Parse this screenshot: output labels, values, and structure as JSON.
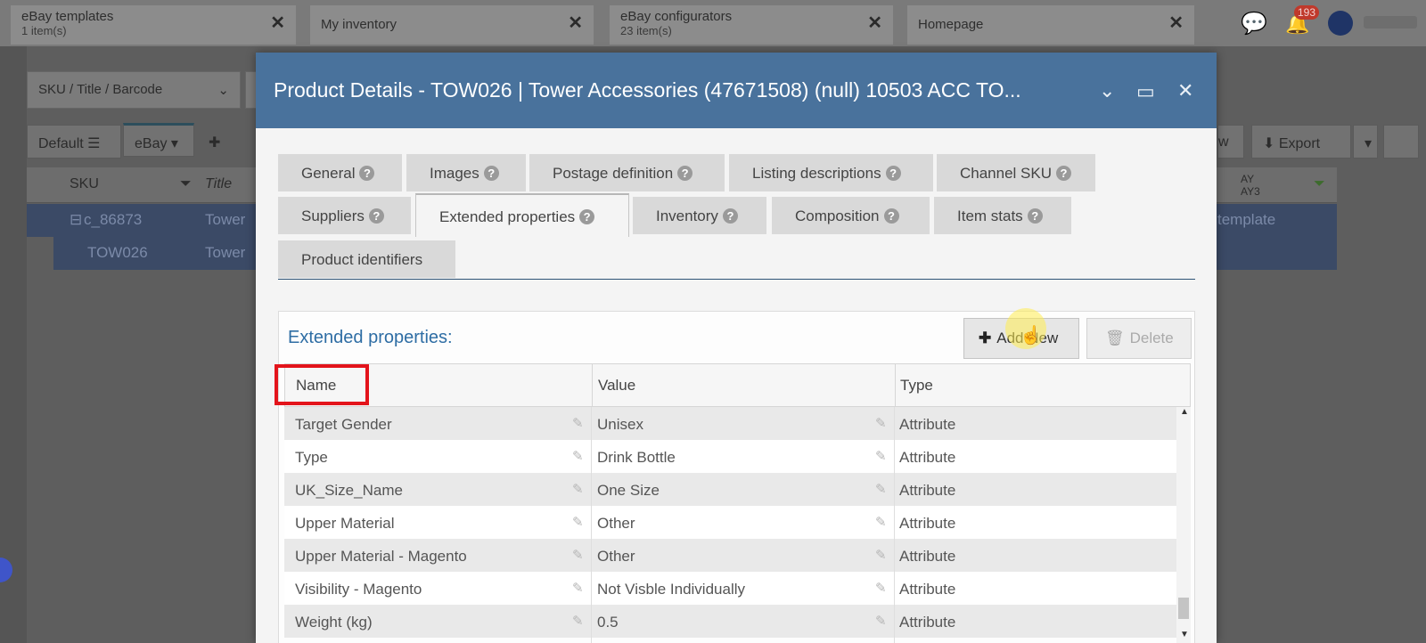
{
  "background": {
    "tabs": [
      {
        "label": "eBay templates",
        "sub": "1 item(s)"
      },
      {
        "label": "My inventory",
        "sub": ""
      },
      {
        "label": "eBay configurators",
        "sub": "23 item(s)"
      },
      {
        "label": "Homepage",
        "sub": ""
      }
    ],
    "notification_count": "193",
    "search_select": "SKU / Title / Barcode",
    "view_default": "Default",
    "view_ebay": "eBay",
    "export_label": "Export",
    "partial_button": "w",
    "grid_headers": {
      "sku": "SKU",
      "title": "Title",
      "right": "AY",
      "right2": "AY3"
    },
    "rows": [
      {
        "sku": "c_86873",
        "title": "Tower",
        "right": "template"
      },
      {
        "sku": "TOW026",
        "title": "Tower",
        "right": ""
      }
    ]
  },
  "modal": {
    "title": "Product Details - TOW026 | Tower Accessories (47671508) (null) 10503 ACC TO...",
    "tabs_row1": [
      "General",
      "Images",
      "Postage definition",
      "Listing descriptions",
      "Channel SKU"
    ],
    "tabs_row2": [
      "Suppliers",
      "Extended properties",
      "Inventory",
      "Composition",
      "Item stats"
    ],
    "tabs_row3": [
      "Product identifiers"
    ],
    "active_tab": "Extended properties",
    "panel_title": "Extended properties:",
    "add_label": "Add New",
    "delete_label": "Delete",
    "columns": [
      "Name",
      "Value",
      "Type"
    ],
    "rows": [
      {
        "name": "Target Gender",
        "value": "Unisex",
        "type": "Attribute"
      },
      {
        "name": "Type",
        "value": "Drink Bottle",
        "type": "Attribute"
      },
      {
        "name": "UK_Size_Name",
        "value": "One Size",
        "type": "Attribute"
      },
      {
        "name": "Upper Material",
        "value": "Other",
        "type": "Attribute"
      },
      {
        "name": "Upper Material - Magento",
        "value": "Other",
        "type": "Attribute"
      },
      {
        "name": "Visibility - Magento",
        "value": "Not Visble Individually",
        "type": "Attribute"
      },
      {
        "name": "Weight (kg)",
        "value": "0.5",
        "type": "Attribute"
      }
    ]
  }
}
